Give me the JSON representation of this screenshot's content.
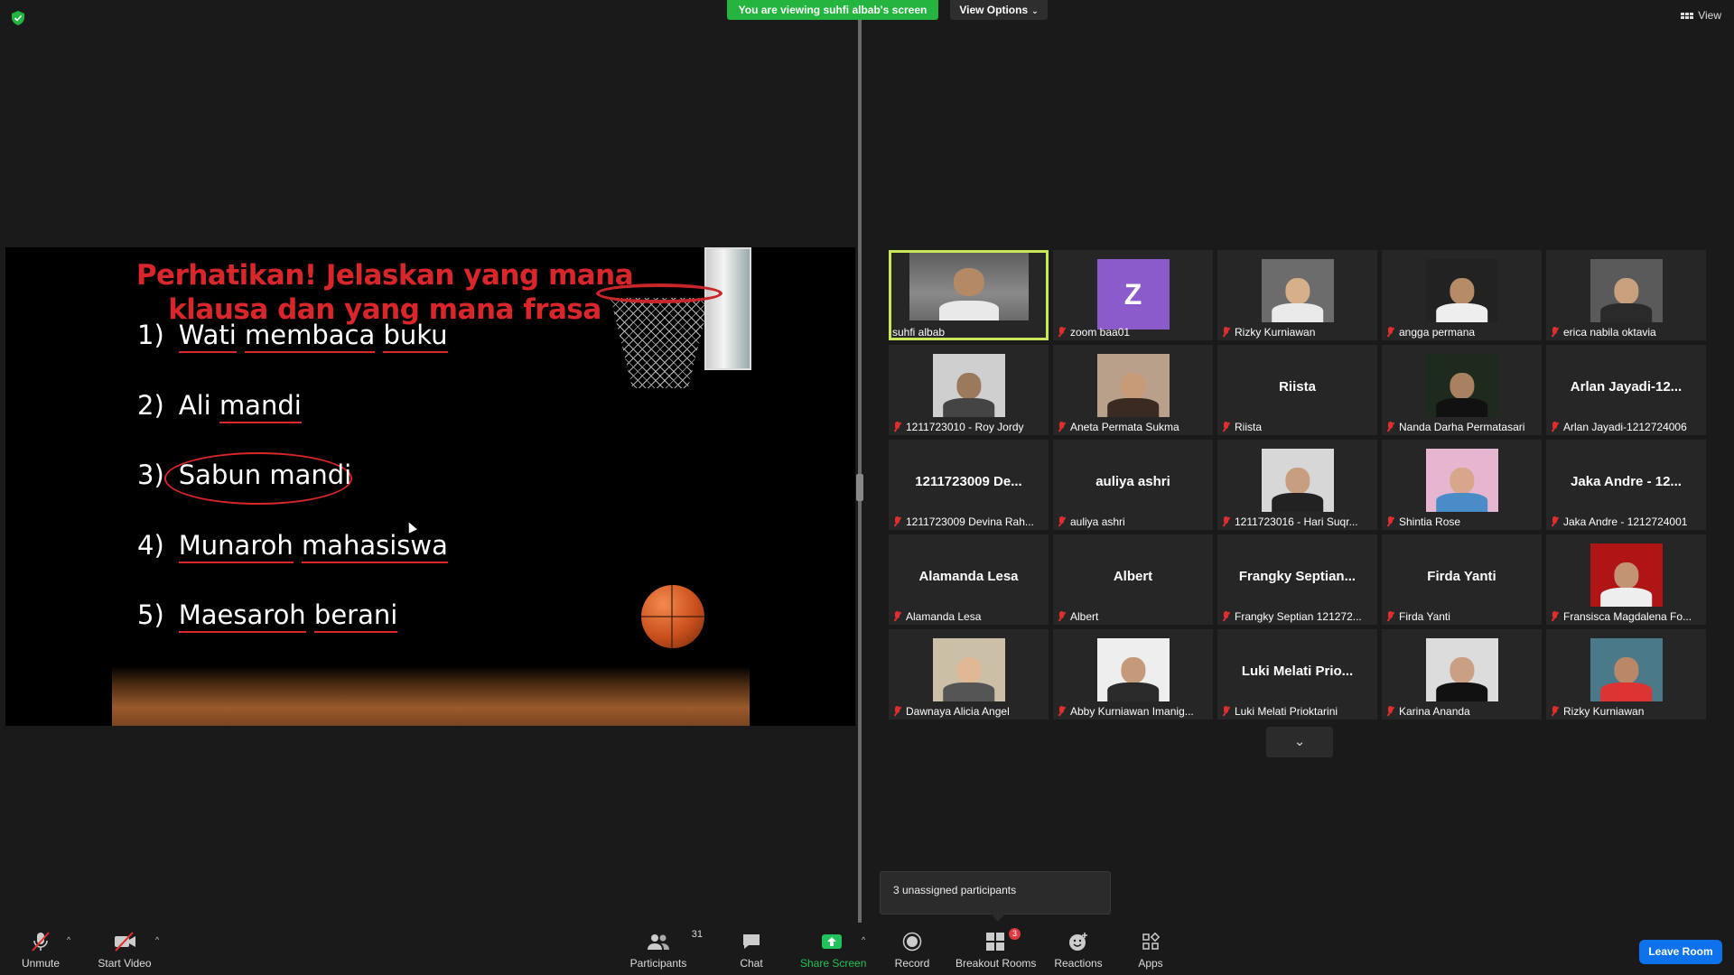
{
  "top": {
    "viewing_banner": "You are viewing suhfi albab's screen",
    "view_options": "View Options",
    "view_label": "View"
  },
  "slide": {
    "title_line1": "Perhatikan! Jelaskan yang mana",
    "title_line2": "klausa dan yang mana frasa",
    "items": [
      {
        "num": "1)",
        "w1": "Wati",
        "w2": "membaca",
        "w3": "buku"
      },
      {
        "num": "2)",
        "w1": "Ali",
        "w2": "mandi"
      },
      {
        "num": "3)",
        "w1": "Sabun",
        "w2": "mandi"
      },
      {
        "num": "4)",
        "w1": "Munaroh",
        "w2": "mahasiswa"
      },
      {
        "num": "5)",
        "w1": "Maesaroh",
        "w2": "berani"
      }
    ],
    "title_color": "#d8262b"
  },
  "participants": [
    {
      "name": "suhfi albab",
      "display": "",
      "kind": "video",
      "active": true
    },
    {
      "name": "zoom baa01",
      "display": "Z",
      "kind": "avatar"
    },
    {
      "name": "Rizky Kurniawan",
      "display": "",
      "kind": "photo"
    },
    {
      "name": "angga permana",
      "display": "",
      "kind": "photo"
    },
    {
      "name": "erica nabila oktavia",
      "display": "",
      "kind": "photo"
    },
    {
      "name": "1211723010 - Roy Jordy",
      "display": "",
      "kind": "photo"
    },
    {
      "name": "Aneta Permata Sukma",
      "display": "",
      "kind": "photo"
    },
    {
      "name": "Riista",
      "display": "Riista",
      "kind": "text"
    },
    {
      "name": "Nanda Darha Permatasari",
      "display": "",
      "kind": "photo"
    },
    {
      "name": "Arlan Jayadi-1212724006",
      "display": "Arlan Jayadi-12...",
      "kind": "text"
    },
    {
      "name": "1211723009 Devina Rah...",
      "display": "1211723009 De...",
      "kind": "text"
    },
    {
      "name": "auliya ashri",
      "display": "auliya ashri",
      "kind": "text"
    },
    {
      "name": "1211723016 - Hari Suqr...",
      "display": "",
      "kind": "photo"
    },
    {
      "name": "Shintia Rose",
      "display": "",
      "kind": "photo"
    },
    {
      "name": "Jaka Andre - 1212724001",
      "display": "Jaka Andre - 12...",
      "kind": "text"
    },
    {
      "name": "Alamanda Lesa",
      "display": "Alamanda Lesa",
      "kind": "text"
    },
    {
      "name": "Albert",
      "display": "Albert",
      "kind": "text"
    },
    {
      "name": "Frangky Septian 121272...",
      "display": "Frangky Septian...",
      "kind": "text"
    },
    {
      "name": "Firda Yanti",
      "display": "Firda Yanti",
      "kind": "text"
    },
    {
      "name": "Fransisca Magdalena Fo...",
      "display": "",
      "kind": "photo"
    },
    {
      "name": "Dawnaya Alicia Angel",
      "display": "",
      "kind": "photo"
    },
    {
      "name": "Abby Kurniawan Imanig...",
      "display": "",
      "kind": "photo"
    },
    {
      "name": "Luki Melati Prioktarini",
      "display": "Luki Melati Prio...",
      "kind": "text"
    },
    {
      "name": "Karina Ananda",
      "display": "",
      "kind": "photo"
    },
    {
      "name": "Rizky Kurniawan",
      "display": "",
      "kind": "photo"
    }
  ],
  "unassigned": "3 unassigned participants",
  "toolbar": {
    "unmute": "Unmute",
    "start_video": "Start Video",
    "participants": "Participants",
    "participants_count": "31",
    "chat": "Chat",
    "share_screen": "Share Screen",
    "record": "Record",
    "breakout_rooms": "Breakout Rooms",
    "breakout_badge": "3",
    "reactions": "Reactions",
    "apps": "Apps",
    "leave_room": "Leave Room"
  }
}
